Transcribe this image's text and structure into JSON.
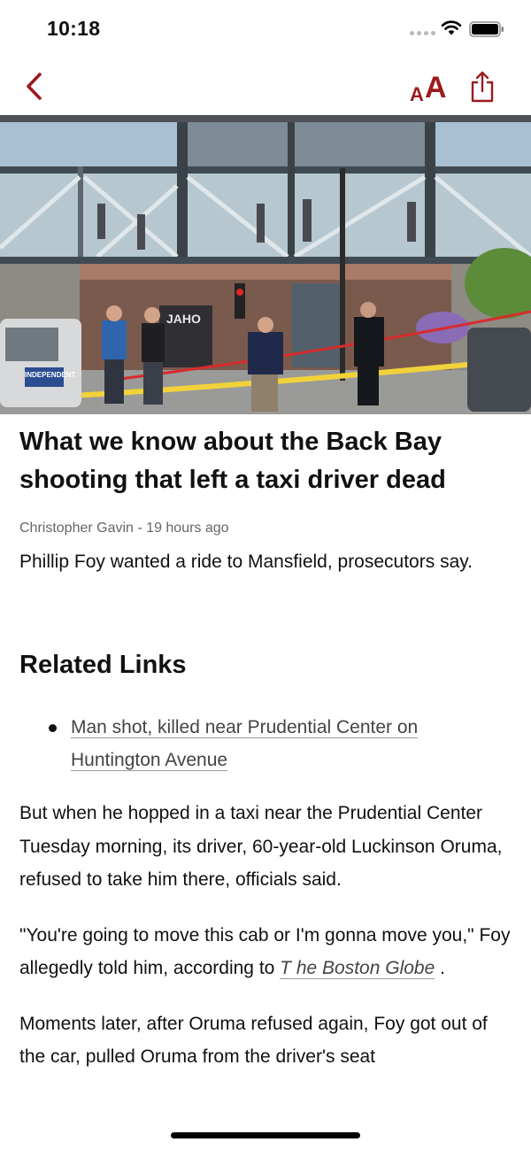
{
  "status_bar": {
    "time": "10:18"
  },
  "nav": {
    "back_icon": "chevron-left-icon",
    "text_size_icon": "text-size-icon",
    "text_size_small": "A",
    "text_size_large": "A",
    "share_icon": "share-icon",
    "accent_color": "#9b1b1e"
  },
  "hero": {
    "storefront_sign": "JAHO",
    "cab_sign": "INDEPENDENT"
  },
  "article": {
    "headline": "What we know about the Back Bay shooting that left a taxi driver dead",
    "byline": "Christopher Gavin - 19 hours ago",
    "dek": "Phillip Foy wanted a ride to Mansfield, prosecutors say.",
    "related_heading": "Related Links",
    "related_links": [
      "Man shot, killed near Prudential Center on Huntington Avenue"
    ],
    "para1": "But when he hopped in a taxi near the Prudential Center Tuesday morning, its driver, 60-year-old Luckinson Oruma, refused to take him there, officials said.",
    "para2_before": "\"You're going to move this cab or I'm gonna move you,\" Foy allegedly told him, according to ",
    "para2_link": "T he Boston Globe",
    "para2_after": " .",
    "para3": "Moments later, after Oruma refused again, Foy got out of the car, pulled Oruma from the driver's seat"
  }
}
